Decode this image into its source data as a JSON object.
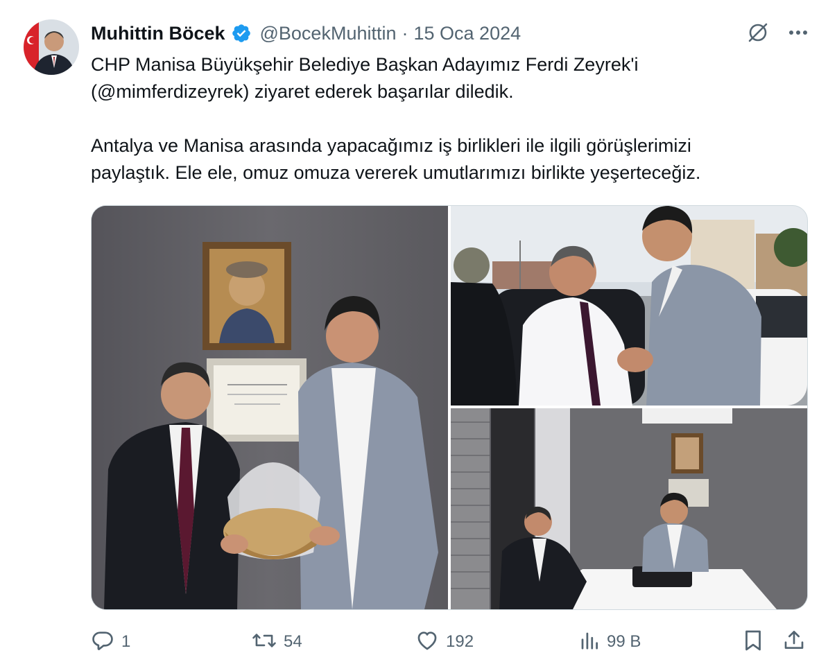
{
  "author": {
    "name": "Muhittin Böcek",
    "handle": "@BocekMuhittin",
    "separator": "·",
    "date": "15 Oca 2024",
    "verified": true,
    "badge_color": "#1d9bf0"
  },
  "tweet_text": {
    "line1": "CHP Manisa Büyükşehir Belediye Başkan Adayımız Ferdi Zeyrek'i",
    "line2": "(@mimferdizeyrek) ziyaret ederek başarılar diledik.",
    "line3": "Antalya ve Manisa arasında yapacağımız iş birlikleri ile ilgili görüşlerimizi",
    "line4": "paylaştık. Ele ele, omuz omuza vererek umutlarımızı birlikte yeşerteceğiz."
  },
  "media": {
    "count": 3
  },
  "stats": {
    "replies": "1",
    "retweets": "54",
    "likes": "192",
    "views": "99 B"
  },
  "icons": {
    "grok": "grok-icon",
    "more": "more-icon",
    "reply": "reply-icon",
    "retweet": "retweet-icon",
    "like": "heart-icon",
    "views": "views-icon",
    "bookmark": "bookmark-icon",
    "share": "share-icon"
  },
  "colors": {
    "text": "#0f1419",
    "secondary": "#536471",
    "border": "#cfd9de"
  }
}
